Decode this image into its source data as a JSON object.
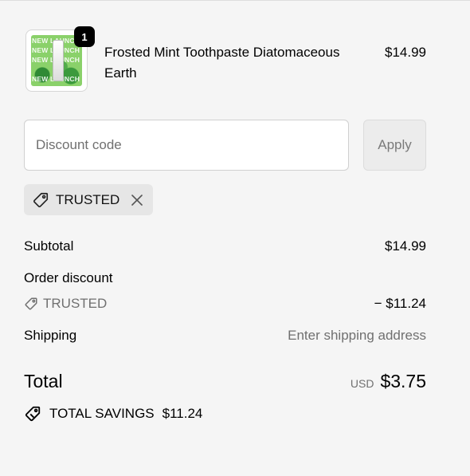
{
  "product": {
    "name": "Frosted Mint Toothpaste Diatomaceous Earth",
    "price": "$14.99",
    "quantity": "1",
    "thumbnail_text": "NEW LAUNCH"
  },
  "discount": {
    "placeholder": "Discount code",
    "apply_label": "Apply",
    "applied_code": "TRUSTED"
  },
  "summary": {
    "subtotal_label": "Subtotal",
    "subtotal_value": "$14.99",
    "order_discount_label": "Order discount",
    "discount_code": "TRUSTED",
    "discount_value": "− $11.24",
    "shipping_label": "Shipping",
    "shipping_value": "Enter shipping address",
    "total_label": "Total",
    "currency": "USD",
    "total_value": "$3.75",
    "savings_label": "TOTAL SAVINGS",
    "savings_value": "$11.24"
  },
  "colors": {
    "background": "#f5f5f5",
    "text": "#000000",
    "muted": "#707070",
    "chip": "#e6e6e6",
    "badge": "#000000"
  },
  "icons": {
    "tag": "tag-icon",
    "close": "close-icon",
    "savings": "savings-tag-icon"
  }
}
